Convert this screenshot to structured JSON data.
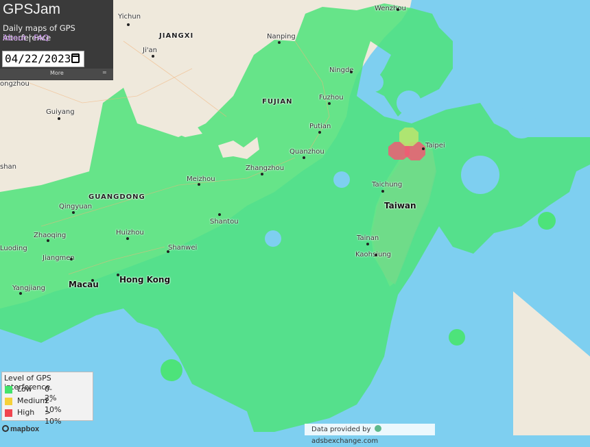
{
  "app": {
    "title": "GPSJam",
    "subtitle": "Daily maps of GPS interference",
    "about_link": "About",
    "separator": "|",
    "faq_link": "FAQ",
    "date_value": "04/22/2023",
    "more_label": "More",
    "menu_glyph": "="
  },
  "legend": {
    "title": "Level of GPS interference",
    "items": [
      {
        "name": "Low",
        "range": "0-2%",
        "color": "#44e36c"
      },
      {
        "name": "Medium",
        "range": "2-10%",
        "color": "#f5d13a"
      },
      {
        "name": "High",
        "range": "> 10%",
        "color": "#f0454f"
      }
    ]
  },
  "colors": {
    "sea": "#7ecff0",
    "land": "#efe9dc",
    "low": "#4de37a",
    "medium": "#b8e66e",
    "high": "#ee5c73"
  },
  "map_labels": {
    "provinces": [
      "JIANGXI",
      "FUJIAN",
      "GUANGDONG"
    ],
    "cities": [
      "Wenzhou",
      "Yichun",
      "Nanping",
      "Ji'an",
      "Ningde",
      "ongzhou",
      "Fuzhou",
      "Guiyang",
      "Putian",
      "Taipei",
      "Quanzhou",
      "shan",
      "Zhangzhou",
      "Meizhou",
      "Taichung",
      "Qingyuan",
      "Shantou",
      "Huizhou",
      "Zhaoqing",
      "Tainan",
      "Luoding",
      "Shanwei",
      "Jiangmen",
      "Kaohsiung",
      "Yangjiang"
    ],
    "major": [
      "Taiwan",
      "Macau",
      "Hong Kong"
    ]
  },
  "footer": {
    "mapbox": "mapbox",
    "data_provided": "Data provided by",
    "source": "adsbexchange.com"
  }
}
